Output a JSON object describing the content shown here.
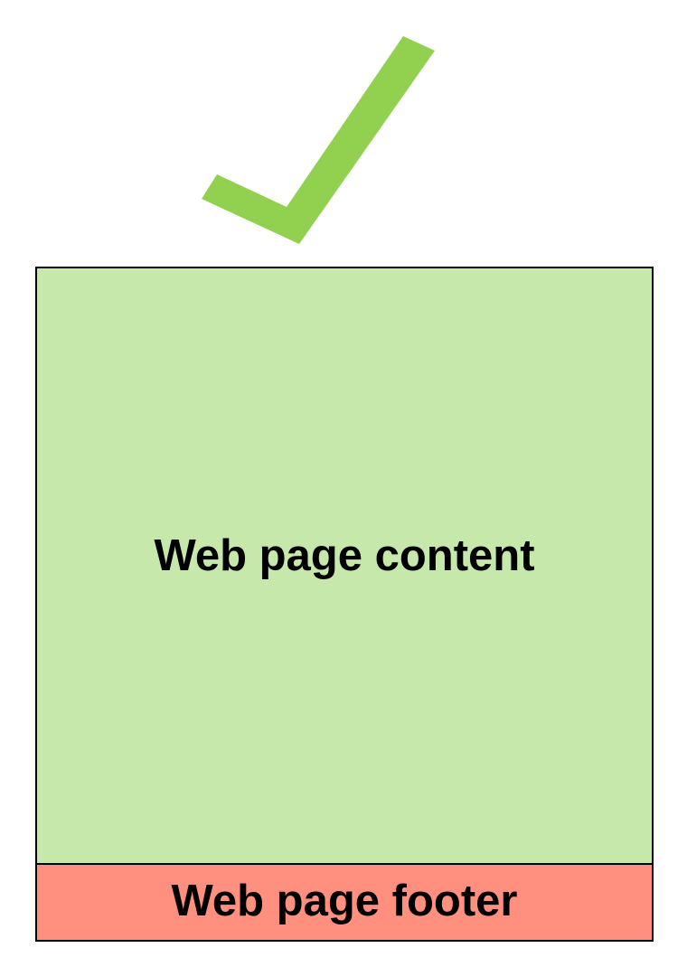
{
  "diagram": {
    "indicator": {
      "icon": "checkmark-icon",
      "color": "#92d050"
    },
    "page": {
      "content": {
        "label": "Web page content",
        "color": "#c6e8aa"
      },
      "footer": {
        "label": "Web page footer",
        "color": "#ff9080"
      }
    }
  }
}
